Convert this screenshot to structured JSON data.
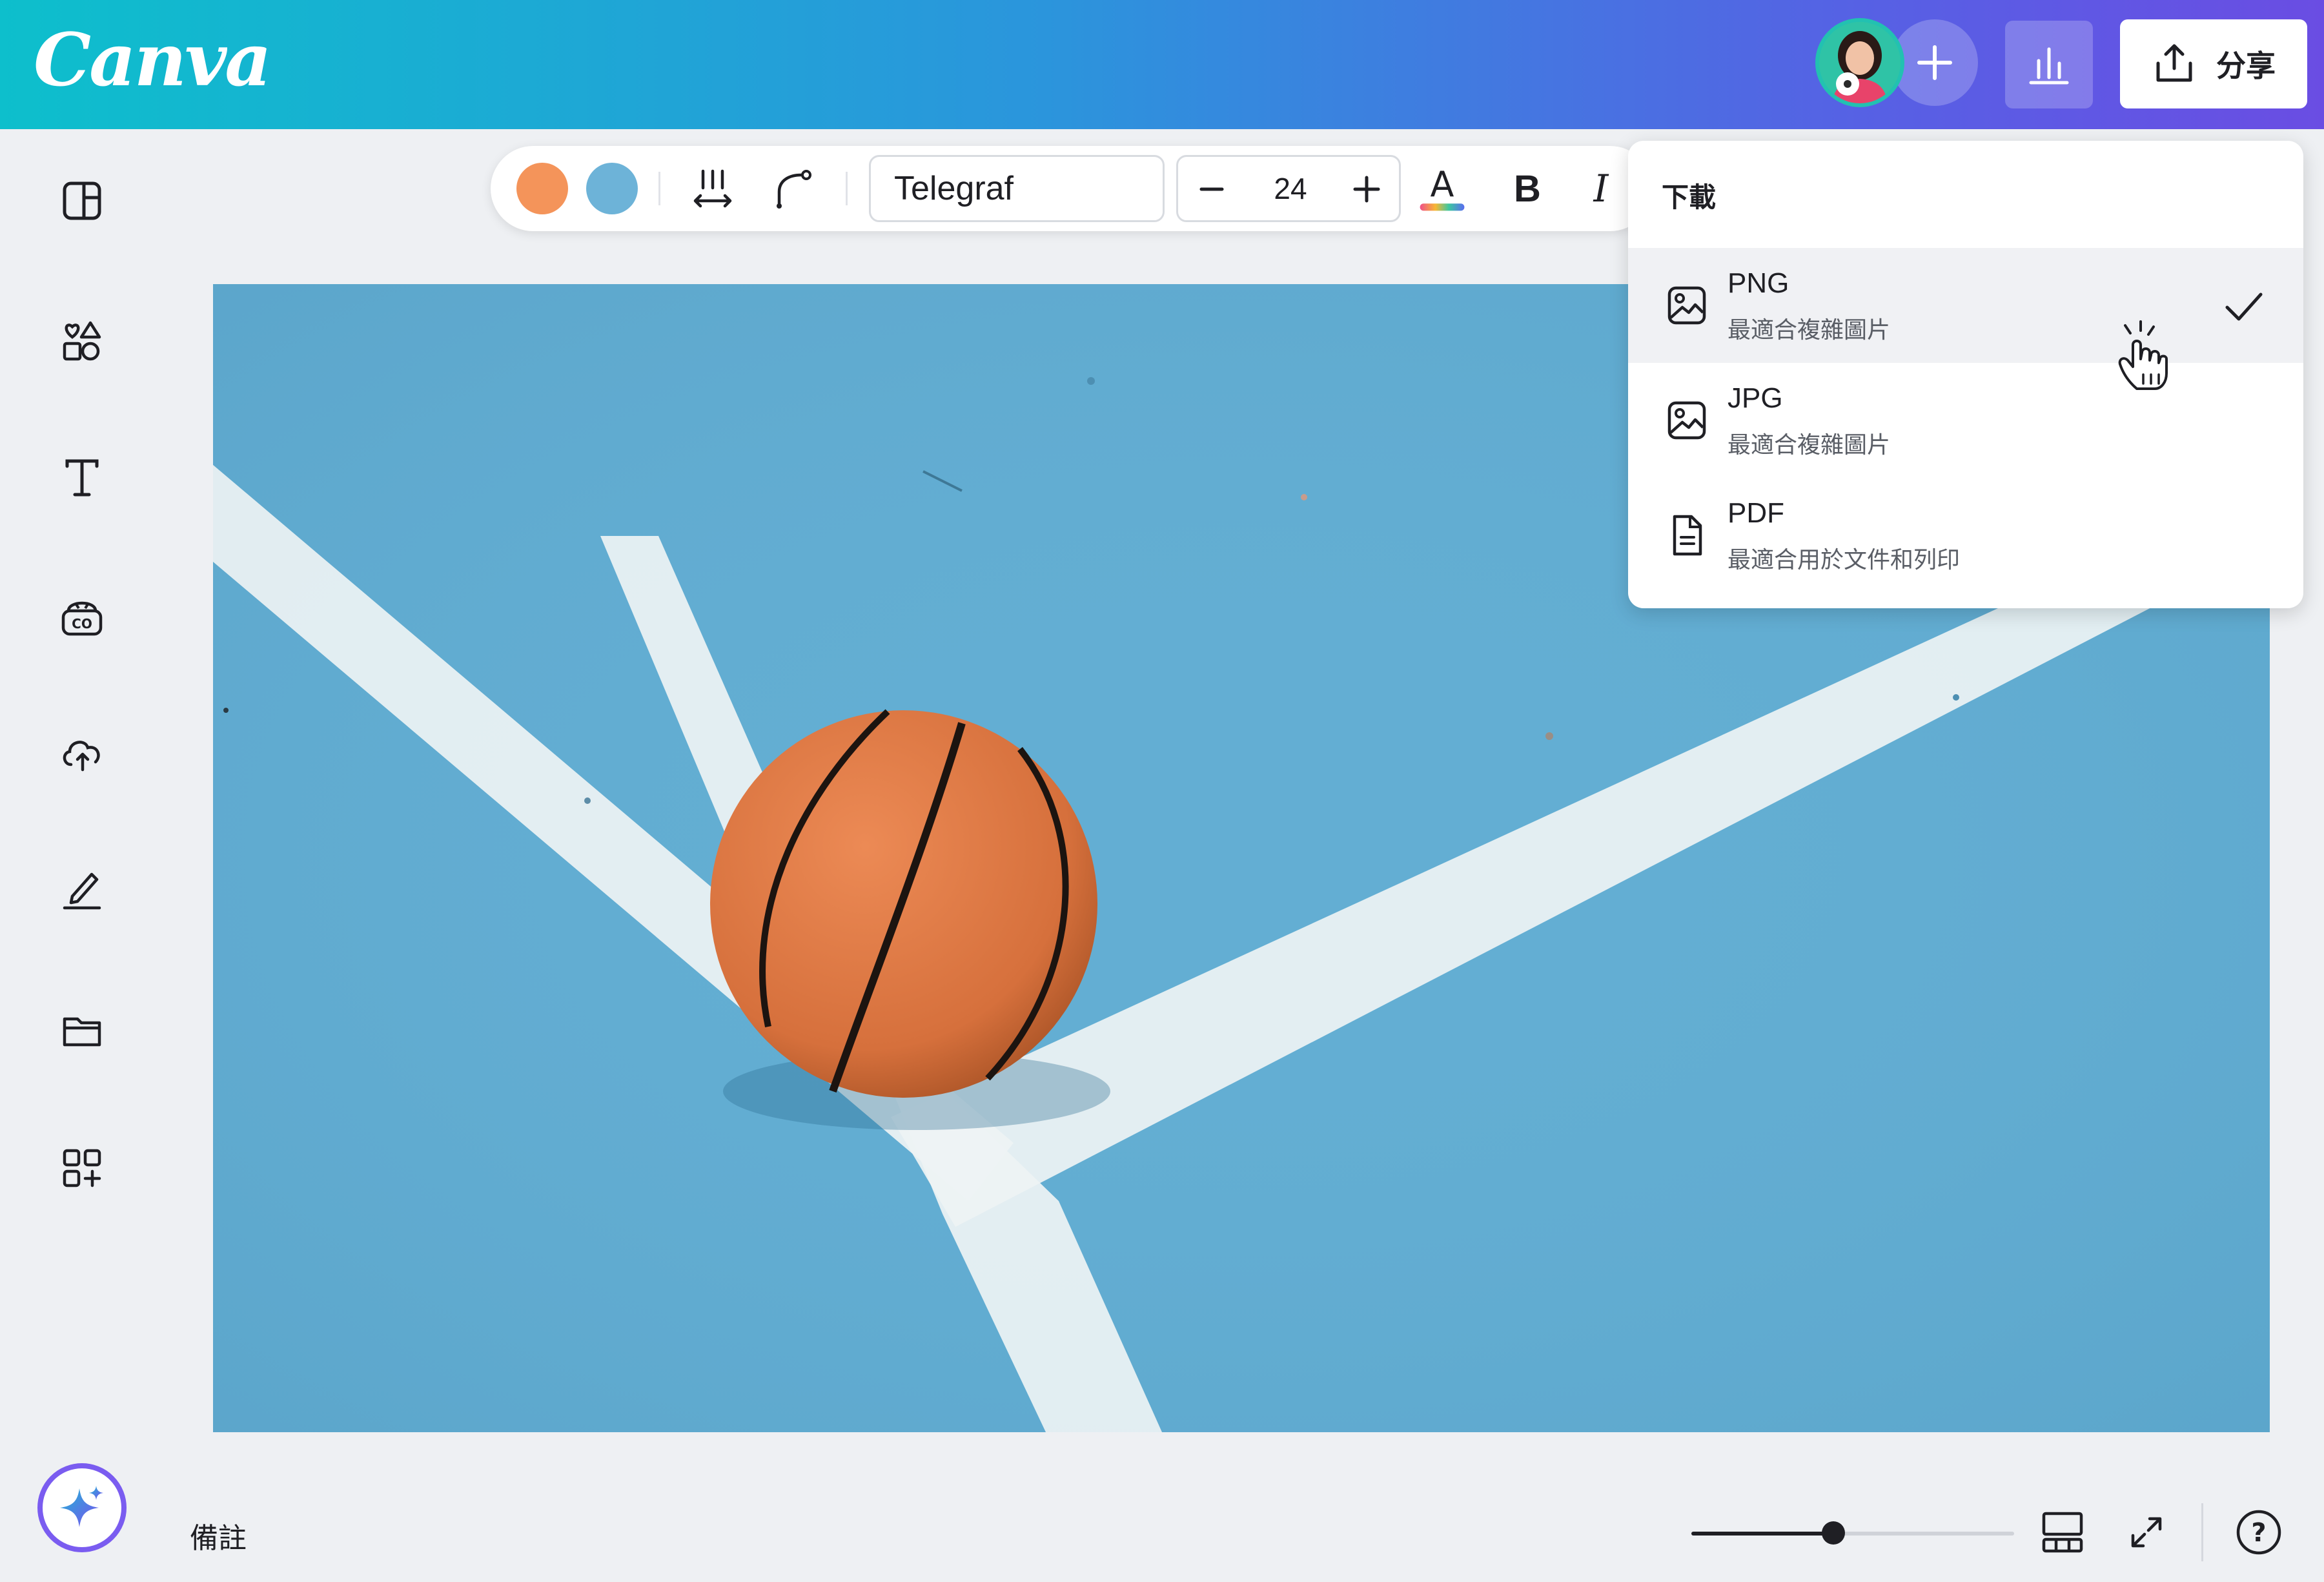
{
  "header": {
    "logo_text": "Canva",
    "share_label": "分享",
    "gradient": [
      "#0dbfcc",
      "#6a4de3"
    ]
  },
  "toolbar": {
    "swatches": [
      "#f4945a",
      "#6db3d8"
    ],
    "font_name": "Telegraf",
    "font_size": "24",
    "bold_label": "B",
    "italic_label": "I",
    "text_color_label": "A"
  },
  "download_menu": {
    "title": "下載",
    "items": [
      {
        "name": "PNG",
        "desc": "最適合複雜圖片",
        "icon": "image-icon",
        "selected": true
      },
      {
        "name": "JPG",
        "desc": "最適合複雜圖片",
        "icon": "image-icon",
        "selected": false
      },
      {
        "name": "PDF",
        "desc": "最適合用於文件和列印",
        "icon": "document-icon",
        "selected": false
      }
    ]
  },
  "left_rail": {
    "icons": [
      "layout-icon",
      "elements-icon",
      "text-icon",
      "brand-icon",
      "uploads-icon",
      "draw-icon",
      "projects-icon",
      "apps-icon"
    ]
  },
  "footer": {
    "notes_label": "備註",
    "zoom_fraction": 0.44,
    "help_label": "?"
  },
  "canvas": {
    "court_color": "#63aed3",
    "ball_color": "#d9743f"
  }
}
